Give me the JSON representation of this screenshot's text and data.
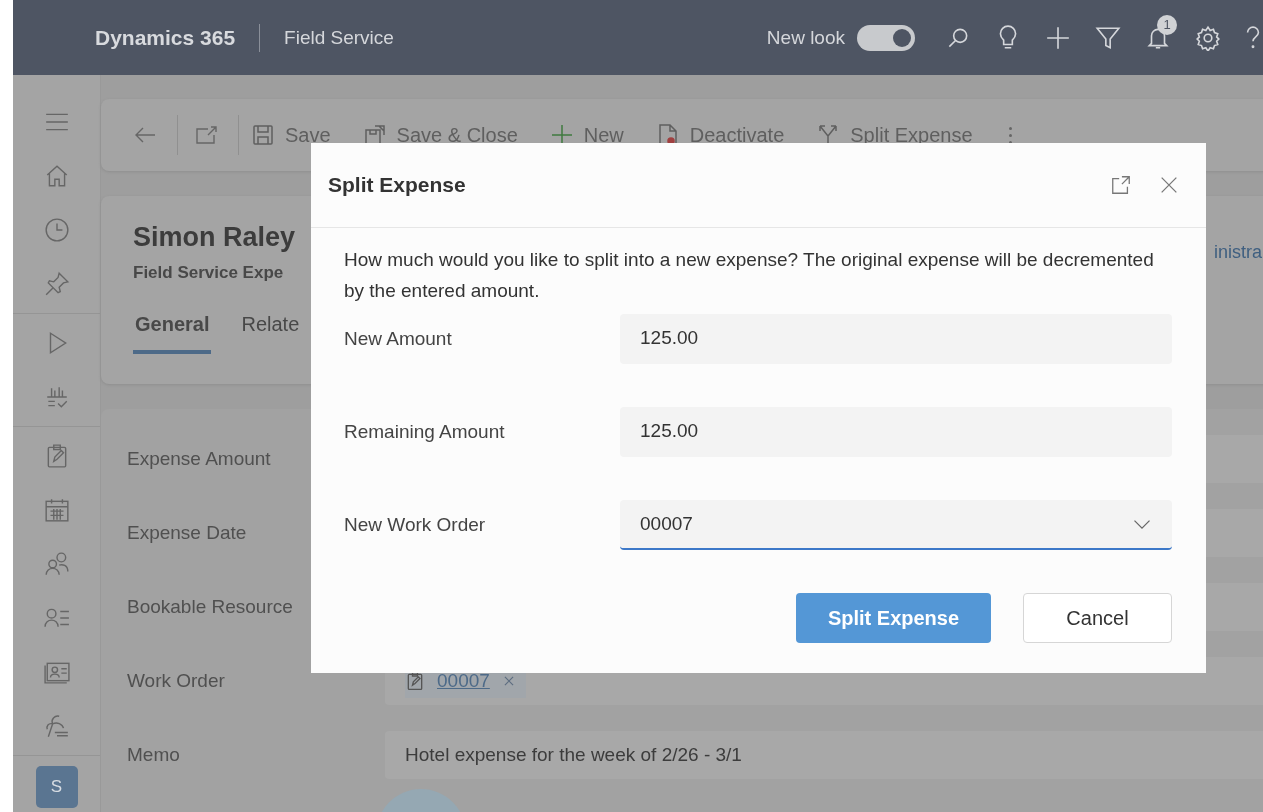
{
  "app": {
    "product": "Dynamics 365",
    "area": "Field Service",
    "new_look": {
      "label": "New look",
      "on": true
    },
    "notification_count": "1",
    "user_initial": "S"
  },
  "command_bar": {
    "buttons": [
      {
        "kind": "save",
        "label": "Save"
      },
      {
        "kind": "save-close",
        "label": "Save & Close"
      },
      {
        "kind": "new",
        "label": "New"
      },
      {
        "kind": "deactivate",
        "label": "Deactivate"
      },
      {
        "kind": "split",
        "label": "Split Expense"
      }
    ]
  },
  "record": {
    "title": "Simon Raley",
    "subtitle": "Field Service Expe",
    "owner": "inistra",
    "tabs": [
      {
        "label": "General",
        "selected": true
      },
      {
        "label": "Relate",
        "selected": false
      }
    ]
  },
  "form": {
    "fields": [
      {
        "kind": "plain",
        "label": "Expense Amount"
      },
      {
        "kind": "plain",
        "label": "Expense Date"
      },
      {
        "kind": "plain",
        "label": "Bookable Resource"
      },
      {
        "kind": "lookup",
        "label": "Work Order",
        "value": "00007"
      },
      {
        "kind": "text",
        "label": "Memo",
        "value": "Hotel expense for the week of 2/26 - 3/1"
      }
    ]
  },
  "dialog": {
    "title": "Split Expense",
    "message": "How much would you like to split into a new expense? The original expense will be decremented by the entered amount.",
    "fields": [
      {
        "kind": "text",
        "label": "New Amount",
        "value": "125.00",
        "focused": false
      },
      {
        "kind": "text",
        "label": "Remaining Amount",
        "value": "125.00",
        "focused": false
      },
      {
        "kind": "select",
        "label": "New Work Order",
        "value": "00007",
        "focused": true
      }
    ],
    "buttons": [
      {
        "kind": "primary",
        "label": "Split Expense"
      },
      {
        "kind": "secondary",
        "label": "Cancel"
      }
    ]
  }
}
